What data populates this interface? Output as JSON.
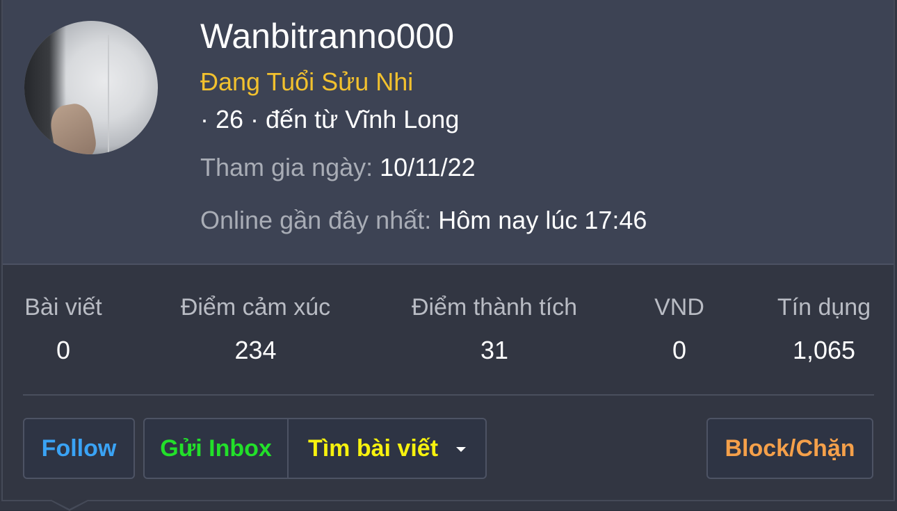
{
  "profile": {
    "username": "Wanbitranno000",
    "title": "Đang Tuổi Sửu Nhi",
    "info": "· 26 · đến từ Vĩnh Long",
    "joined_label": "Tham gia ngày:",
    "joined_value": "10/11/22",
    "last_online_label": "Online gần đây nhất:",
    "last_online_value": "Hôm nay lúc 17:46"
  },
  "stats": [
    {
      "label": "Bài viết",
      "value": "0"
    },
    {
      "label": "Điểm cảm xúc",
      "value": "234"
    },
    {
      "label": "Điểm thành tích",
      "value": "31"
    },
    {
      "label": "VND",
      "value": "0"
    },
    {
      "label": "Tín dụng",
      "value": "1,065"
    }
  ],
  "actions": {
    "follow": "Follow",
    "inbox": "Gửi Inbox",
    "search_posts": "Tìm bài viết",
    "block": "Block/Chặn"
  },
  "colors": {
    "title": "#f2c12e",
    "follow": "#3aa3f5",
    "inbox": "#22e02a",
    "search_posts": "#f7f20e",
    "block": "#f5a04a"
  }
}
